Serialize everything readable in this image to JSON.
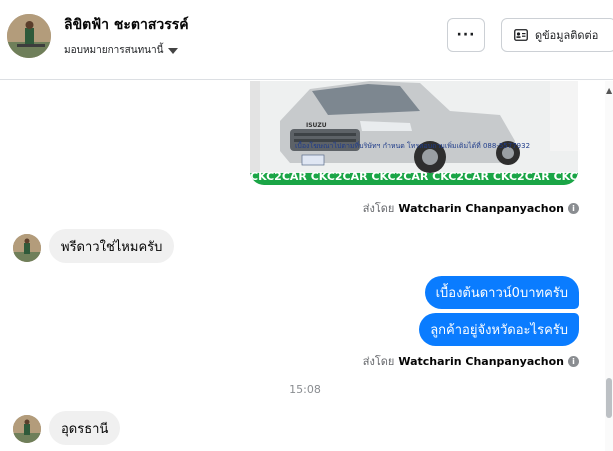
{
  "header": {
    "contact_name": "ลิขิตฟ้า ชะตาสวรรค์",
    "assign_label": "มอบหมายการสนทนานี้",
    "more_label": "···",
    "profile_button_label": "ดูข้อมูลติดต่อ"
  },
  "photo": {
    "caption": "เบื้องโฆษณาไปตามที่บริษัทฯ กำหนด โทรสอบถามเพิ่มเติมได้ที่ 088-5577932",
    "watermark": "CKC2CAR CKC2CAR CKC2CAR CKC2CAR CKC2CAR CKC2",
    "brand": "ISUZU"
  },
  "messages": {
    "sent_by_prefix": "ส่งโดย",
    "sender_name": "Watcharin Chanpanyachon",
    "info_icon": "i",
    "incoming_1": "พรีดาวใช่ไหมครับ",
    "outgoing_1": "เบื้องต้นดาวน์0บาทครับ",
    "outgoing_2": "ลูกค้าอยู่จังหวัดอะไรครับ",
    "timestamp": "15:08",
    "incoming_2": "อุดรธานี"
  },
  "colors": {
    "outgoing_bubble": "#0a7cff",
    "incoming_bubble": "#f0f0f0",
    "watermark_band": "#1aa546"
  }
}
